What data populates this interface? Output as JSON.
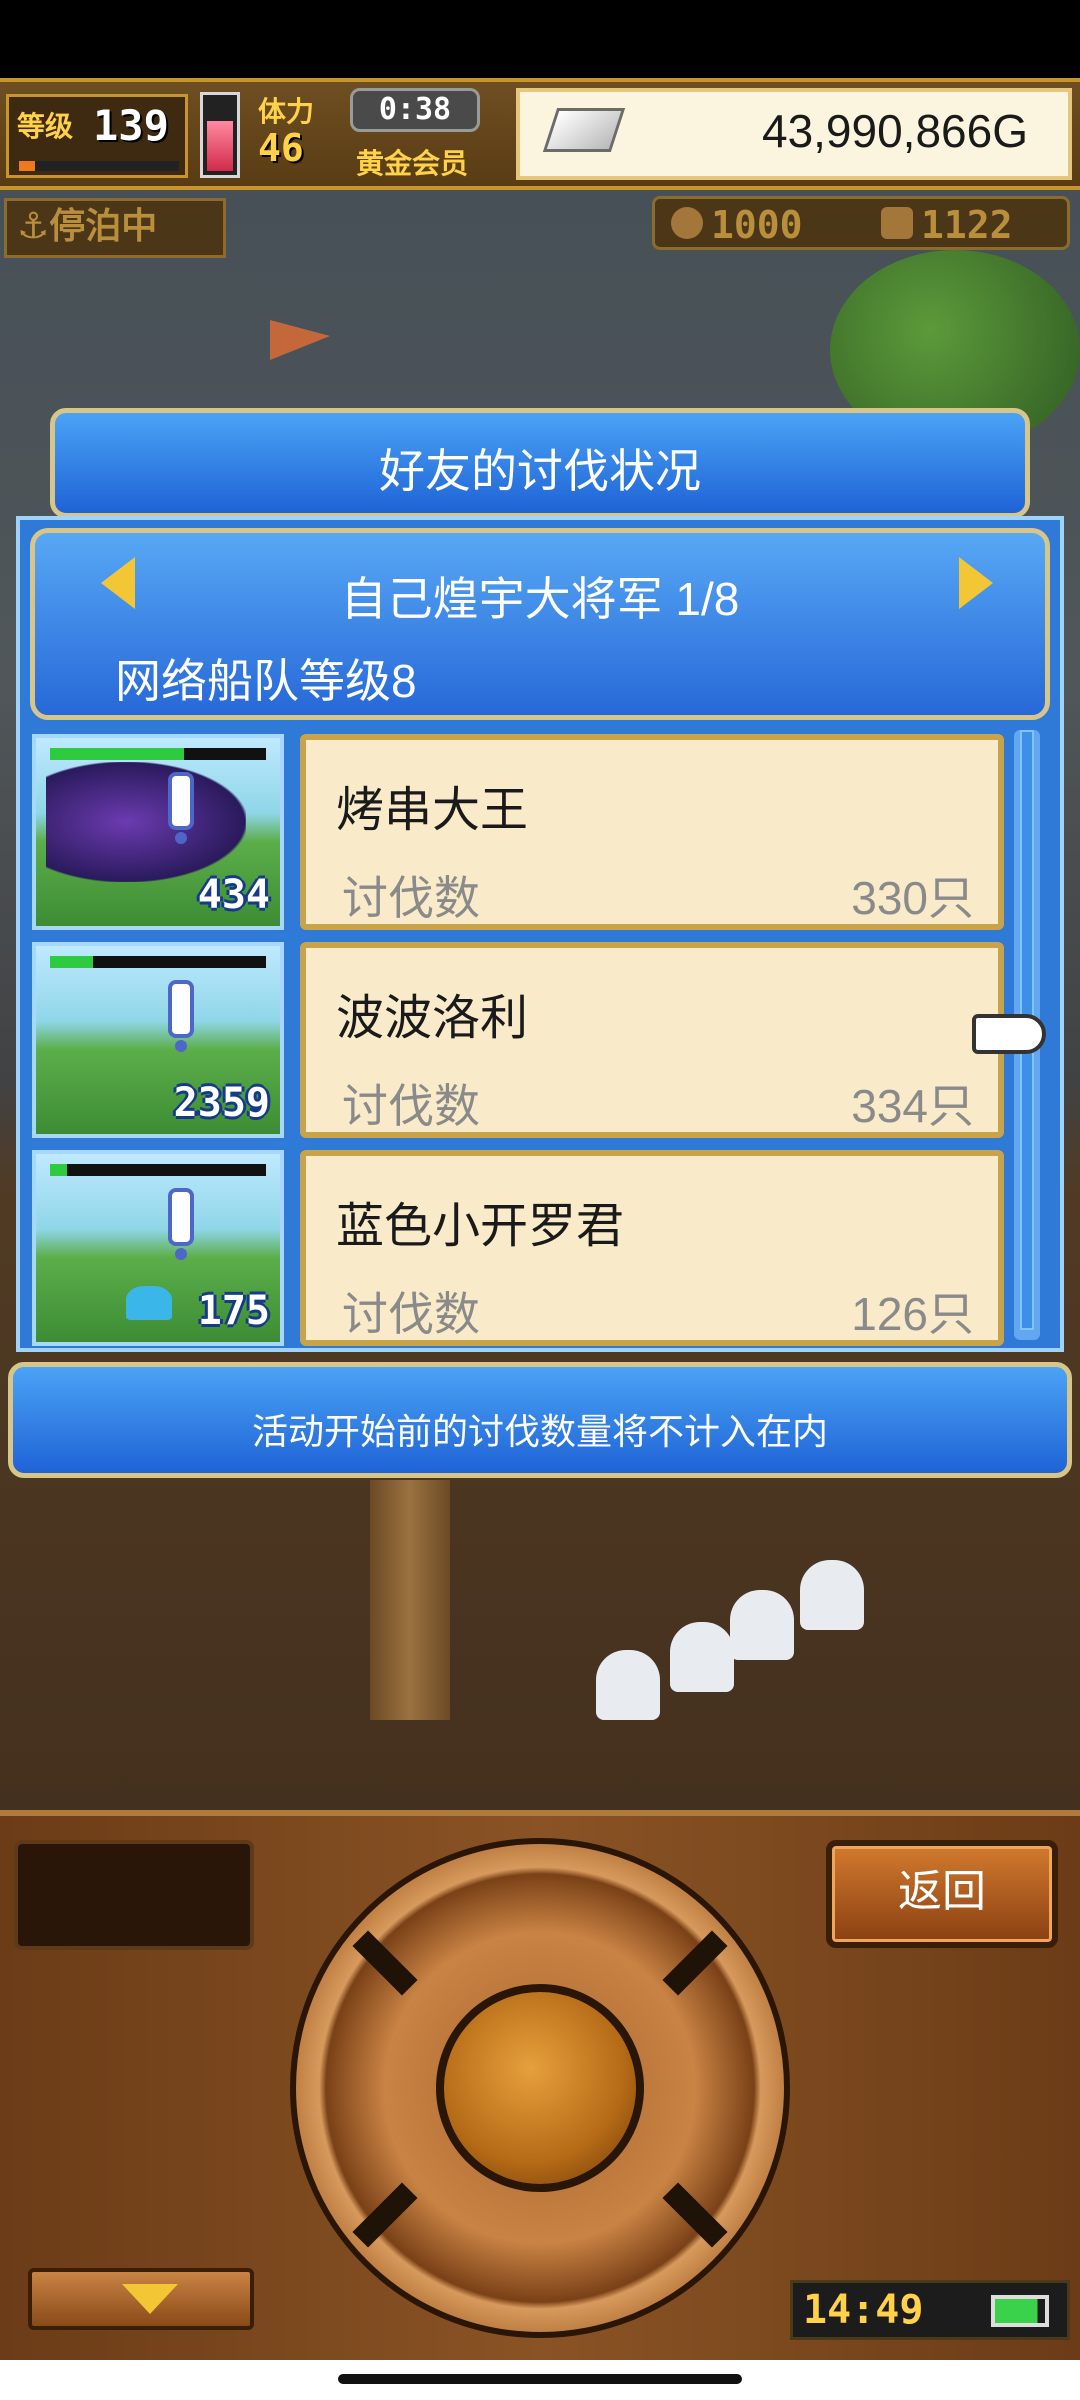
{
  "hud": {
    "level_label": "等级",
    "level_value": "139",
    "level_progress": 0.1,
    "stamina_level": 0.62,
    "stamina_label": "体力",
    "stamina_value": "46",
    "timer": "0:38",
    "membership": "黄金会员",
    "gold": "43,990,866G",
    "status": "停泊中",
    "resource_1": "1000",
    "resource_2": "1122"
  },
  "dialog": {
    "title": "好友的讨伐状况",
    "friend_name": "自己煌宇大将军 1/8",
    "fleet_level": "网络船队等级8",
    "notice": "活动开始前的讨伐数量将不计入在内",
    "entries": [
      {
        "name": "烤串大王",
        "label": "讨伐数",
        "value": "330只",
        "thumb_count": "434",
        "hp": 0.62
      },
      {
        "name": "波波洛利",
        "label": "讨伐数",
        "value": "334只",
        "thumb_count": "2359",
        "hp": 0.2
      },
      {
        "name": "蓝色小开罗君",
        "label": "讨伐数",
        "value": "126只",
        "thumb_count": "175",
        "hp": 0.08
      }
    ]
  },
  "controls": {
    "back_label": "返回",
    "clock": "14:49"
  },
  "colors": {
    "banner_blue": "#1f63d6",
    "card_bg": "#f9ebc9",
    "gold_yellow": "#f3c636"
  },
  "icons": {
    "anchor": "anchor-icon",
    "silver_bar": "silver-ingot-icon",
    "left_arrow": "left-arrow-icon",
    "right_arrow": "right-arrow-icon",
    "pointer": "pointing-hand-icon",
    "battery": "battery-icon"
  }
}
